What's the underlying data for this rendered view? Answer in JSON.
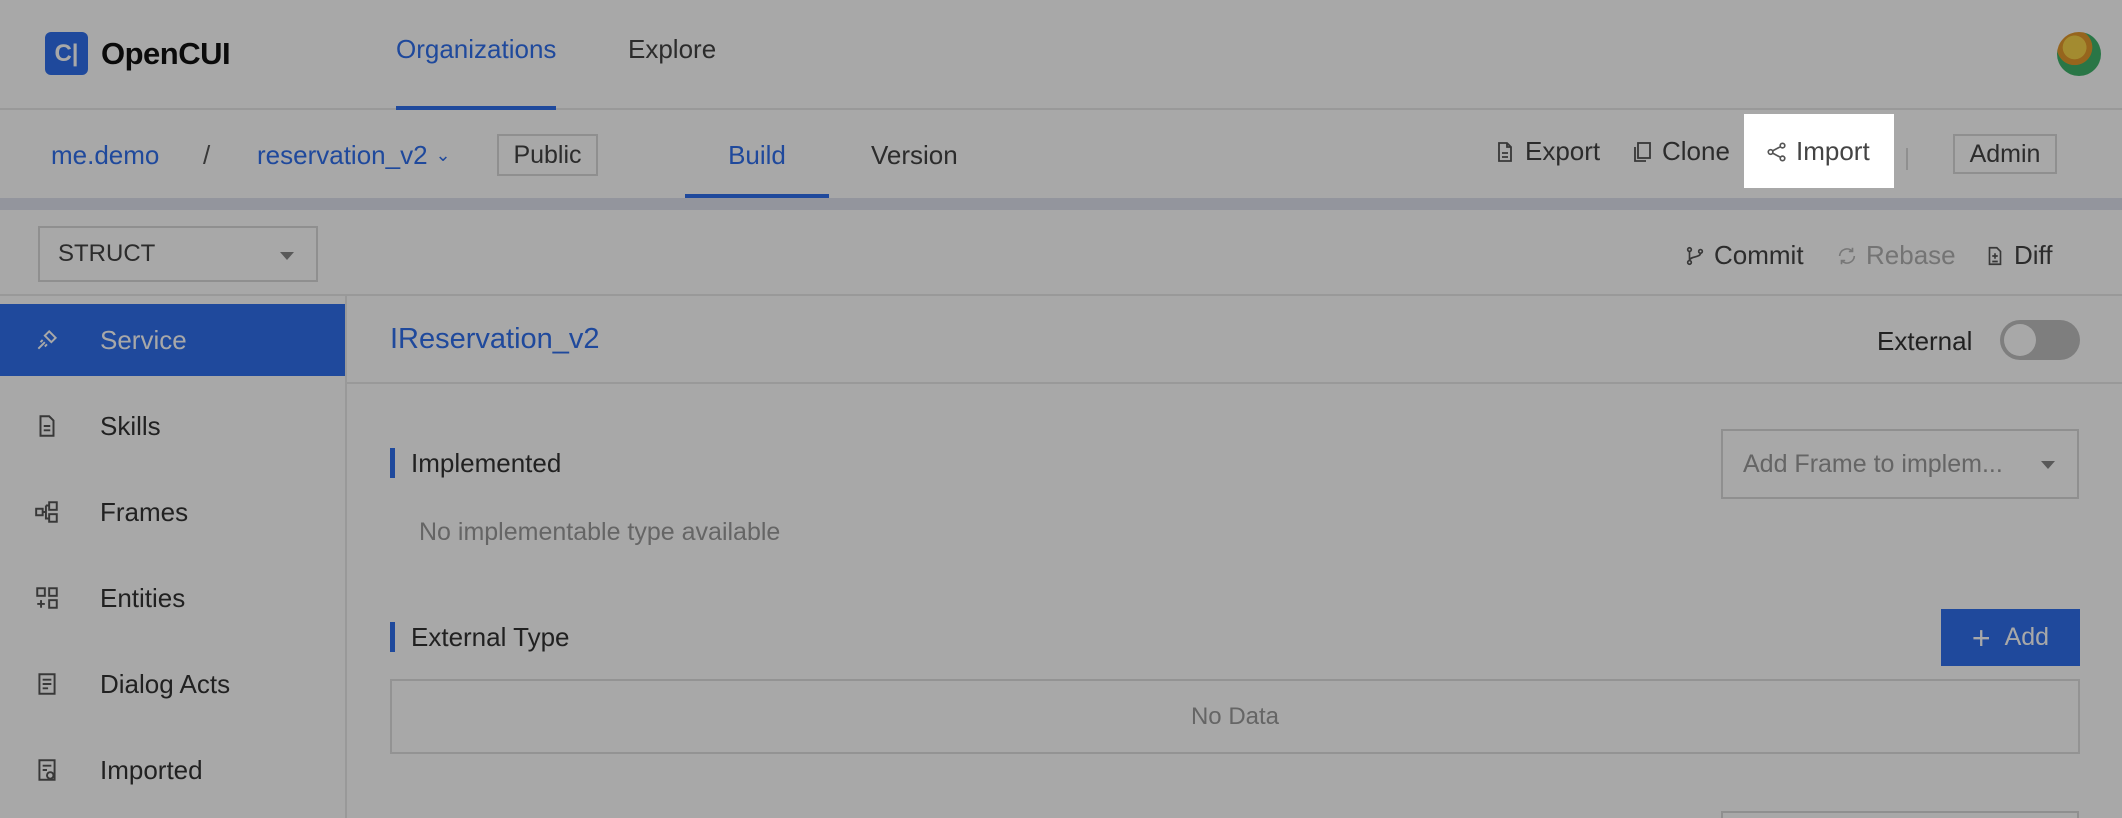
{
  "app": {
    "name": "OpenCUI",
    "logo_glyph": "C|"
  },
  "top_nav": {
    "organizations": "Organizations",
    "explore": "Explore"
  },
  "project_bar": {
    "org": "me.demo",
    "separator": "/",
    "project": "reservation_v2",
    "visibility": "Public",
    "tabs": {
      "build": "Build",
      "version": "Version"
    },
    "actions": {
      "export": "Export",
      "clone": "Clone",
      "import": "Import",
      "admin": "Admin"
    }
  },
  "toolbar": {
    "type_select": "STRUCT",
    "commit": "Commit",
    "rebase": "Rebase",
    "diff": "Diff"
  },
  "sidebar": {
    "items": [
      {
        "label": "Service",
        "icon": "plug-icon",
        "active": true
      },
      {
        "label": "Skills",
        "icon": "document-icon",
        "active": false
      },
      {
        "label": "Frames",
        "icon": "frames-icon",
        "active": false
      },
      {
        "label": "Entities",
        "icon": "entities-icon",
        "active": false
      },
      {
        "label": "Dialog Acts",
        "icon": "dialog-acts-icon",
        "active": false
      },
      {
        "label": "Imported",
        "icon": "imported-icon",
        "active": false
      }
    ]
  },
  "main": {
    "title": "IReservation_v2",
    "external_label": "External",
    "external_on": false,
    "implemented": {
      "title": "Implemented",
      "select_placeholder": "Add Frame to implem...",
      "empty": "No implementable type available"
    },
    "external_type": {
      "title": "External Type",
      "add_label": "Add",
      "empty": "No Data"
    }
  },
  "colors": {
    "accent": "#2f6fed",
    "mask": "rgba(0,0,0,0.34)"
  }
}
